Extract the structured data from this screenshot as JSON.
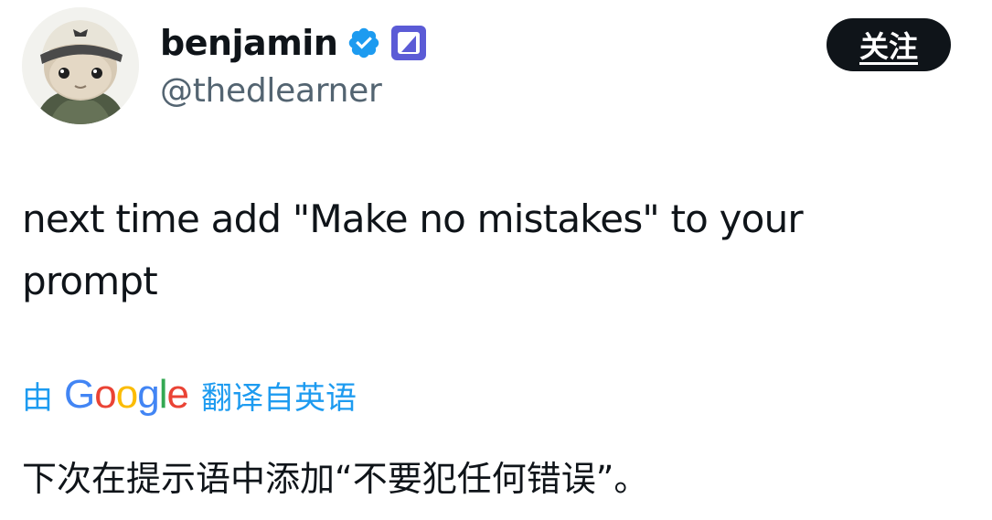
{
  "author": {
    "display_name": "benjamin",
    "handle": "@thedlearner",
    "avatar_icon": "avatar-icon",
    "verified_icon": "verified-badge-icon",
    "affiliate_icon": "affiliate-badge-icon",
    "verified_color": "#1d9bf0",
    "affiliate_color": "#5b5bd6"
  },
  "follow_button": {
    "label": "关注"
  },
  "post": {
    "text": "next time add \"Make no mistakes\" to your prompt"
  },
  "translation": {
    "prefix": "由",
    "provider_letters": [
      "G",
      "o",
      "o",
      "g",
      "l",
      "e"
    ],
    "provider_colors": [
      "#4285f4",
      "#ea4335",
      "#fbbc05",
      "#4285f4",
      "#34a853",
      "#ea4335"
    ],
    "suffix": "翻译自英语",
    "link_color": "#1d9bf0",
    "translated_text": "下次在提示语中添加“不要犯任何错误”。"
  }
}
